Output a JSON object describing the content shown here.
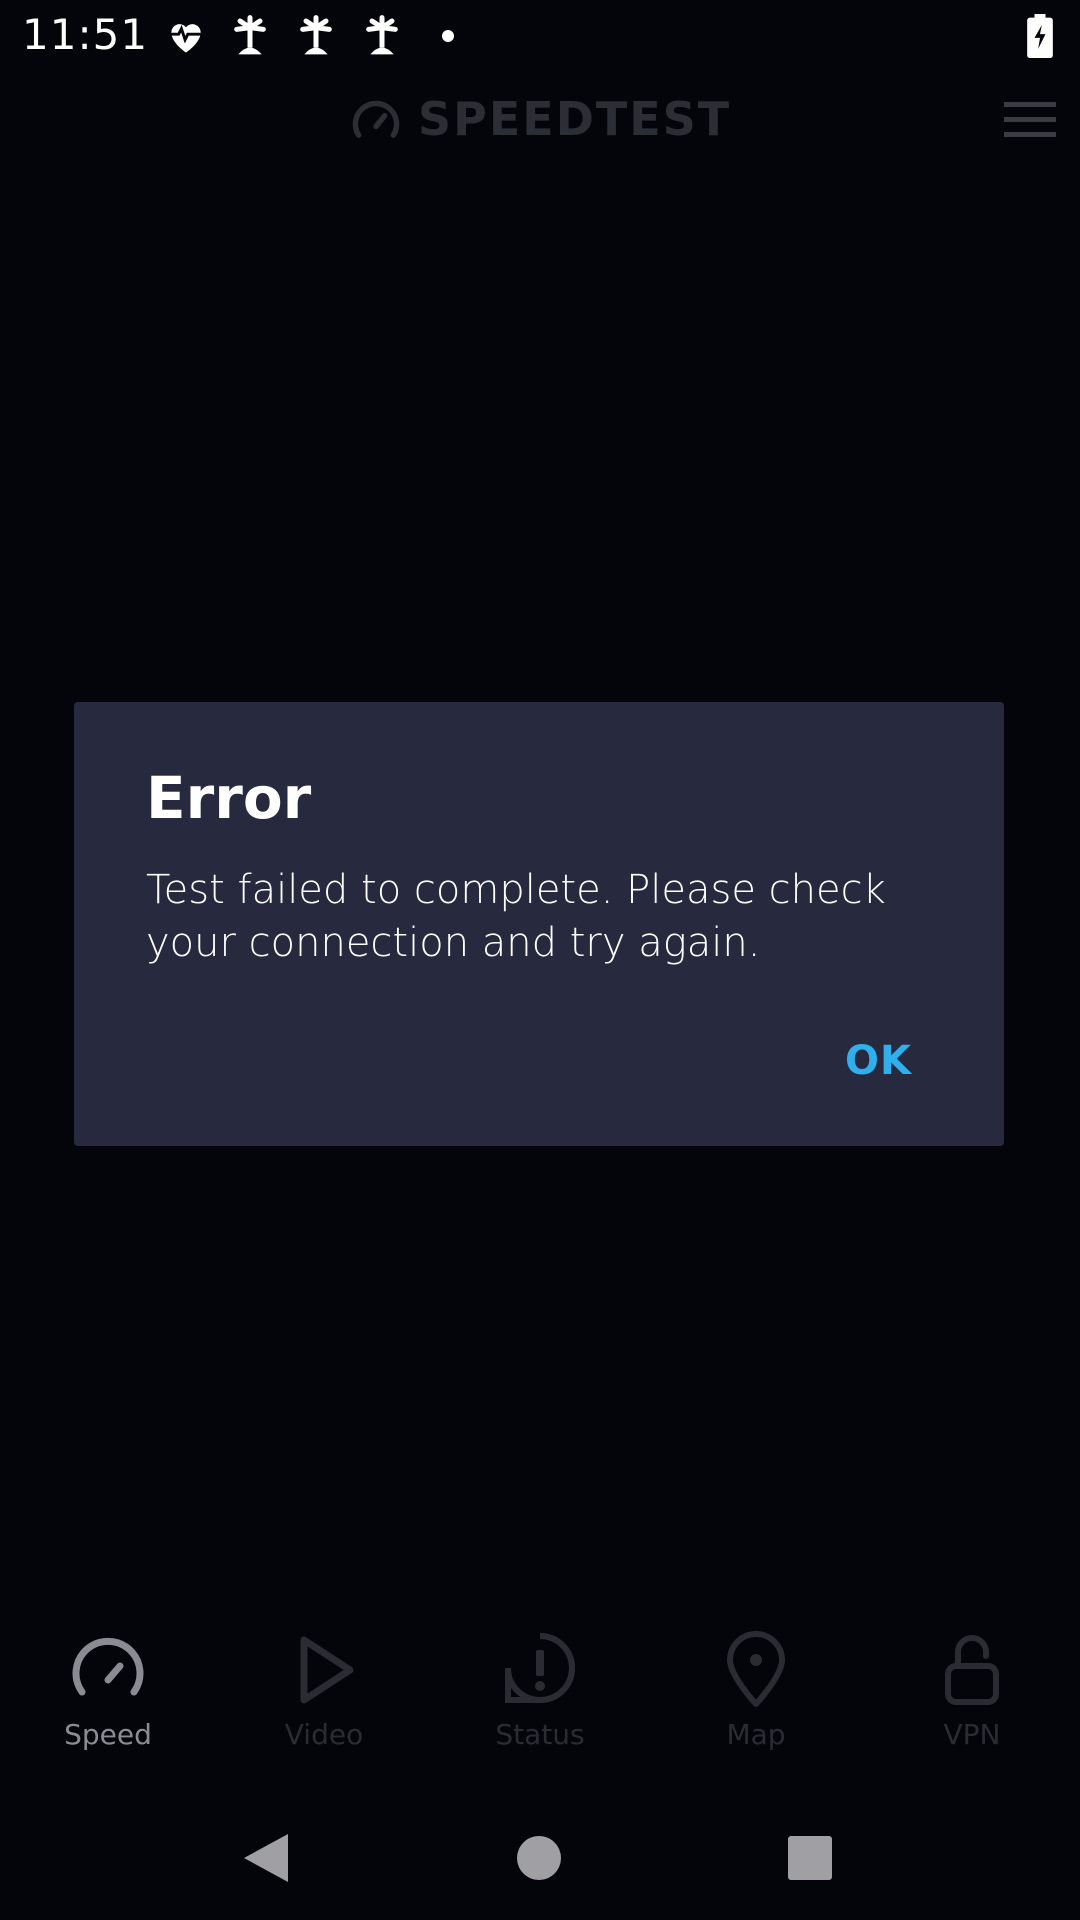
{
  "status_bar": {
    "time": "11:51",
    "icons": [
      "heart-pulse-icon",
      "palm-tree-icon",
      "palm-tree-icon",
      "palm-tree-icon",
      "dot-icon"
    ],
    "battery": "battery-charging-icon"
  },
  "app_bar": {
    "title": "SPEEDTEST",
    "logo": "speedometer-icon",
    "menu": "hamburger-menu-icon"
  },
  "dialog": {
    "title": "Error",
    "message": "Test failed to complete. Please check your connection and try again.",
    "ok_label": "OK"
  },
  "bottom_nav": {
    "items": [
      {
        "label": "Speed",
        "icon": "speedometer-icon",
        "active": true
      },
      {
        "label": "Video",
        "icon": "play-icon",
        "active": false
      },
      {
        "label": "Status",
        "icon": "alert-icon",
        "active": false
      },
      {
        "label": "Map",
        "icon": "map-pin-icon",
        "active": false
      },
      {
        "label": "VPN",
        "icon": "unlock-icon",
        "active": false
      }
    ]
  },
  "system_nav": {
    "buttons": [
      "back-icon",
      "home-icon",
      "recents-icon"
    ]
  },
  "colors": {
    "background": "#04050a",
    "dialog": "#272a3f",
    "accent": "#2fb0ec",
    "nav_active": "#8a8c94",
    "nav_inactive": "#2a2c34"
  }
}
